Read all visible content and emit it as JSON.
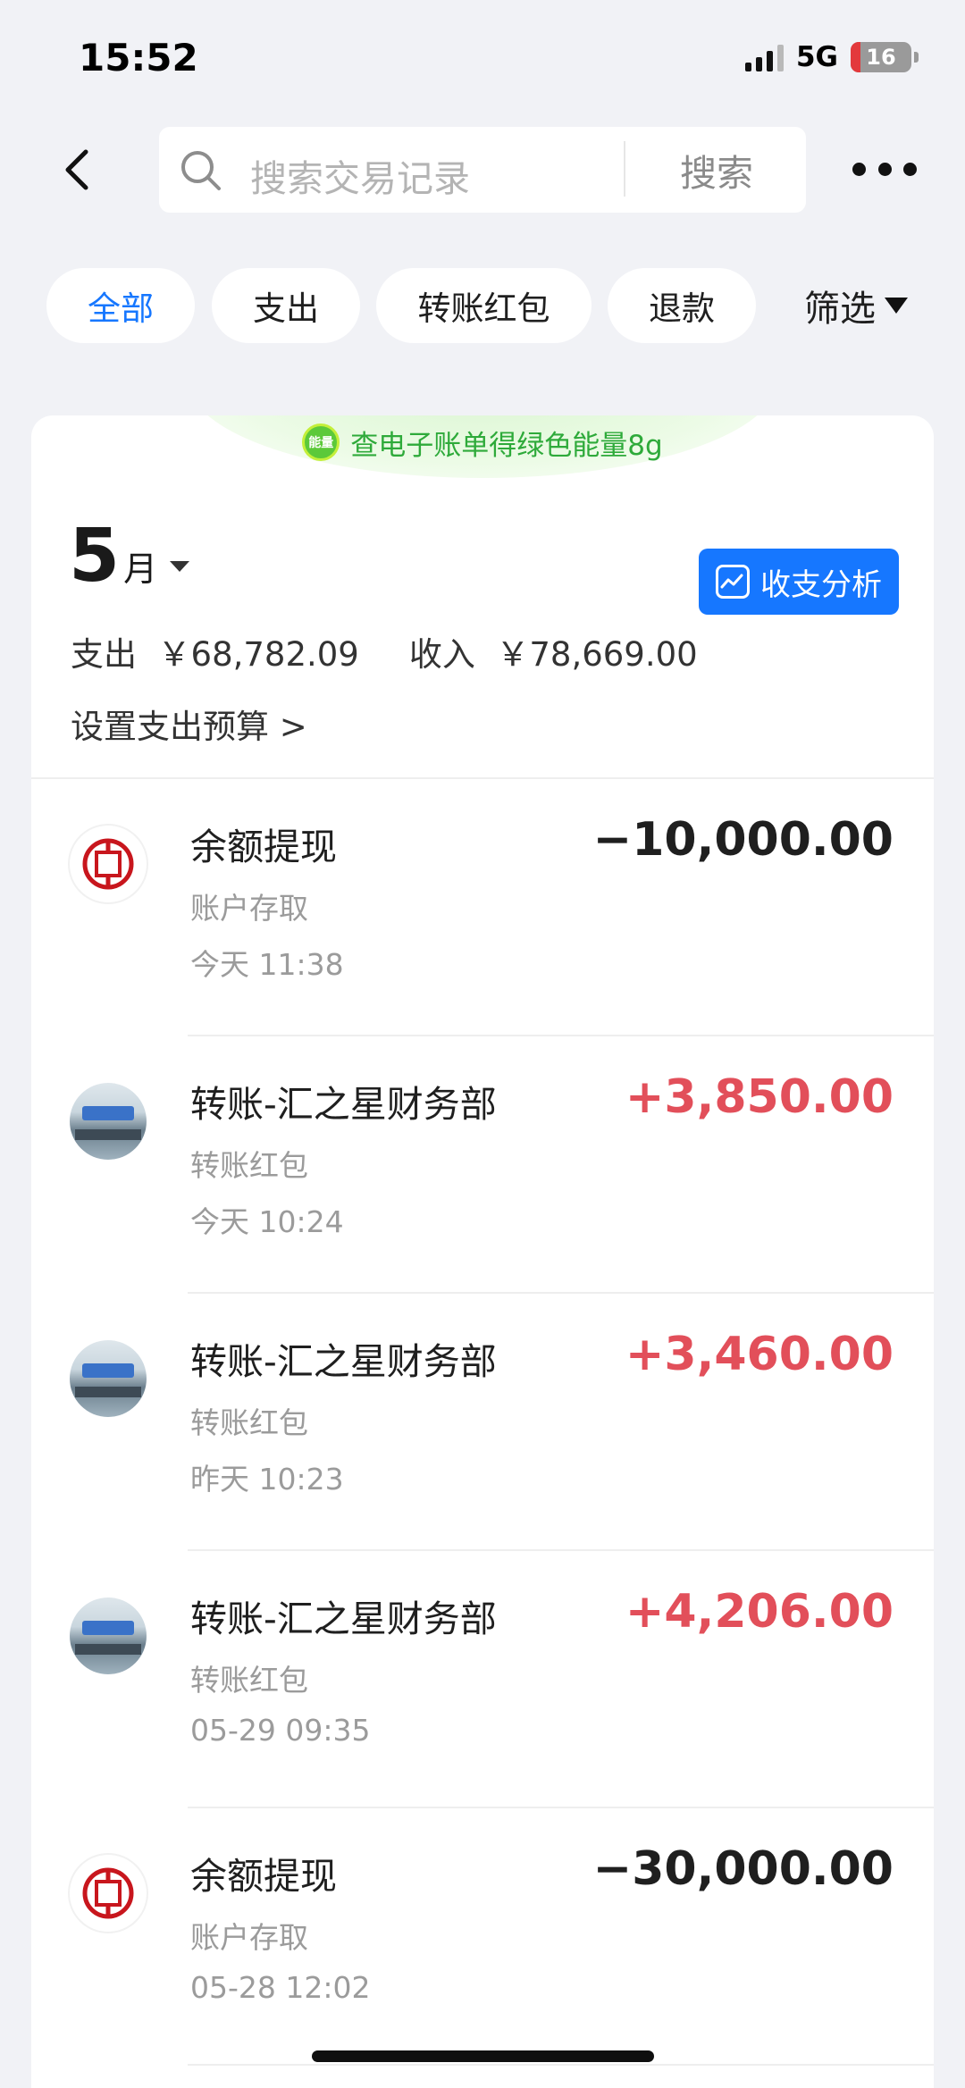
{
  "status_bar": {
    "time": "15:52",
    "network": "5G",
    "battery": "16",
    "battery_level": 0.16
  },
  "search": {
    "placeholder": "搜索交易记录",
    "button_label": "搜索"
  },
  "filters": {
    "chips": [
      "全部",
      "支出",
      "转账红包",
      "退款"
    ],
    "active_index": 0,
    "filter_label": "筛选"
  },
  "banner": {
    "icon_text": "能量",
    "text": "查电子账单得绿色能量8g"
  },
  "month": {
    "number": "5",
    "unit": "月",
    "analysis_button": "收支分析",
    "expense_label": "支出",
    "expense_value": "￥68,782.09",
    "income_label": "收入",
    "income_value": "￥78,669.00",
    "budget_link": "设置支出预算 >"
  },
  "transactions": [
    {
      "title": "余额提现",
      "category": "账户存取",
      "time": "今天 11:38",
      "amount": "−10,000.00",
      "type": "expense",
      "avatar": "bank"
    },
    {
      "title": "转账-汇之星财务部",
      "category": "转账红包",
      "time": "今天 10:24",
      "amount": "+3,850.00",
      "type": "income",
      "avatar": "photo"
    },
    {
      "title": "转账-汇之星财务部",
      "category": "转账红包",
      "time": "昨天 10:23",
      "amount": "+3,460.00",
      "type": "income",
      "avatar": "photo"
    },
    {
      "title": "转账-汇之星财务部",
      "category": "转账红包",
      "time": "05-29 09:35",
      "amount": "+4,206.00",
      "type": "income",
      "avatar": "photo"
    },
    {
      "title": "余额提现",
      "category": "账户存取",
      "time": "05-28 12:02",
      "amount": "−30,000.00",
      "type": "expense",
      "avatar": "bank"
    }
  ],
  "colors": {
    "accent": "#1677ff",
    "income": "#e24f5a",
    "bank_red": "#c8161d"
  }
}
